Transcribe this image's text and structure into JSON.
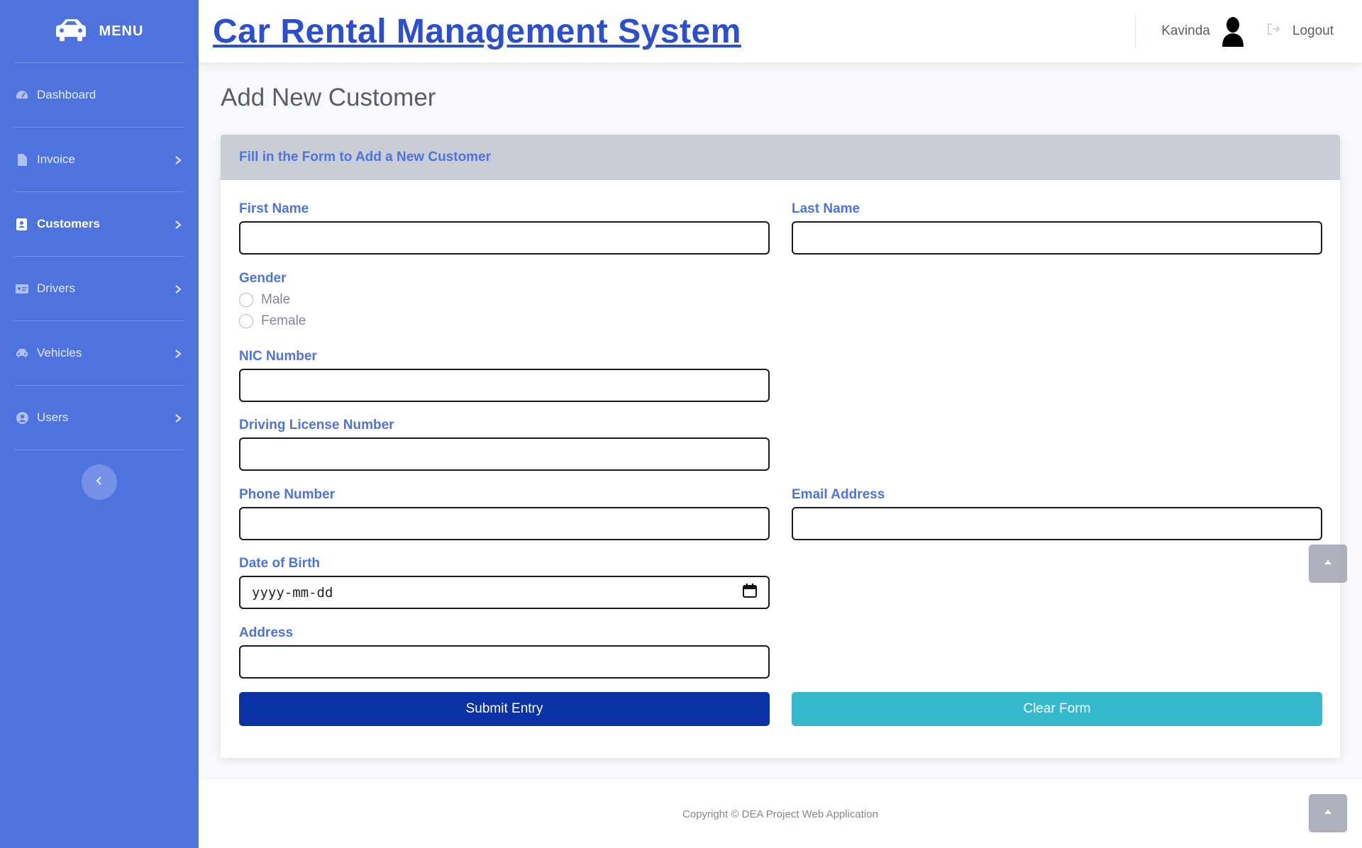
{
  "sidebar": {
    "brand": {
      "label": "MENU",
      "icon": "car-icon"
    },
    "items": [
      {
        "label": "Dashboard",
        "icon": "tachometer-icon",
        "has_chevron": false,
        "active": false
      },
      {
        "label": "Invoice",
        "icon": "file-icon",
        "has_chevron": true,
        "active": false
      },
      {
        "label": "Customers",
        "icon": "address-book-icon",
        "has_chevron": true,
        "active": true
      },
      {
        "label": "Drivers",
        "icon": "id-card-icon",
        "has_chevron": true,
        "active": false
      },
      {
        "label": "Vehicles",
        "icon": "car-icon",
        "has_chevron": true,
        "active": false
      },
      {
        "label": "Users",
        "icon": "user-circle-icon",
        "has_chevron": true,
        "active": false
      }
    ],
    "toggle_icon": "chevron-left-icon"
  },
  "topbar": {
    "title": "Car Rental Management System",
    "user_name": "Kavinda",
    "logout_label": "Logout"
  },
  "page": {
    "title": "Add New Customer"
  },
  "form": {
    "header": "Fill in the Form to Add a New Customer",
    "first_name": {
      "label": "First Name",
      "value": ""
    },
    "last_name": {
      "label": "Last Name",
      "value": ""
    },
    "gender": {
      "label": "Gender",
      "options": [
        "Male",
        "Female"
      ],
      "selected": null
    },
    "nic": {
      "label": "NIC Number",
      "value": ""
    },
    "license": {
      "label": "Driving License Number",
      "value": ""
    },
    "phone": {
      "label": "Phone Number",
      "value": ""
    },
    "email": {
      "label": "Email Address",
      "value": ""
    },
    "dob": {
      "label": "Date of Birth",
      "placeholder": "yyyy-mm-dd"
    },
    "address": {
      "label": "Address",
      "value": ""
    },
    "submit_label": "Submit Entry",
    "clear_label": "Clear Form"
  },
  "footer": {
    "copyright": "Copyright © DEA Project Web Application"
  },
  "colors": {
    "sidebar": "#4e73df",
    "accent": "#4e73df",
    "title": "#2b4fcf",
    "submit": "#0832a6",
    "clear": "#36b9cc"
  }
}
